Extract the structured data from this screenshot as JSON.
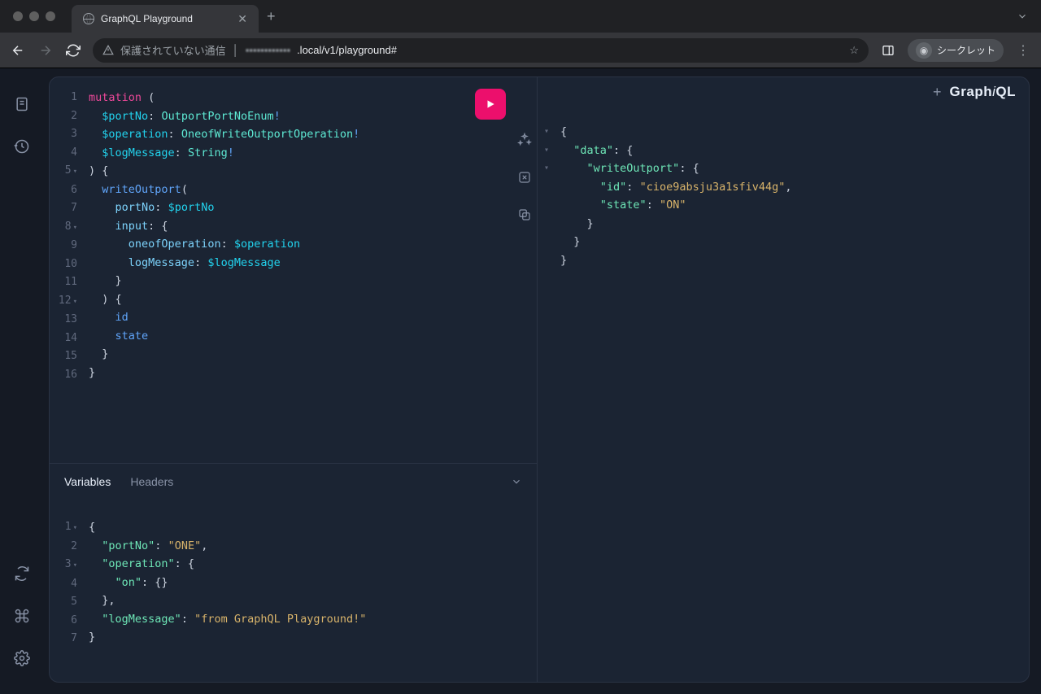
{
  "browser": {
    "tab_title": "GraphQL Playground",
    "address_warning": "保護されていない通信",
    "address_host_obscured": "▪▪▪▪▪▪▪▪▪▪▪▪",
    "address_path": ".local/v1/playground#",
    "incognito_label": "シークレット"
  },
  "brand": {
    "pre": "Graph",
    "i": "i",
    "post": "QL"
  },
  "vars_panel": {
    "tab_variables": "Variables",
    "tab_headers": "Headers"
  },
  "query": {
    "lines": [
      {
        "n": "1",
        "fold": "",
        "html": "<span class='k-mut'>mutation</span> <span class='k-punc'>(</span>"
      },
      {
        "n": "2",
        "fold": "",
        "html": "  <span class='k-var'>$portNo</span><span class='k-punc'>:</span> <span class='k-type'>OutportPortNoEnum</span><span class='k-bang'>!</span>"
      },
      {
        "n": "3",
        "fold": "",
        "html": "  <span class='k-var'>$operation</span><span class='k-punc'>:</span> <span class='k-type'>OneofWriteOutportOperation</span><span class='k-bang'>!</span>"
      },
      {
        "n": "4",
        "fold": "",
        "html": "  <span class='k-var'>$logMessage</span><span class='k-punc'>:</span> <span class='k-type'>String</span><span class='k-bang'>!</span>"
      },
      {
        "n": "5",
        "fold": "▾",
        "html": "<span class='k-punc'>) {</span>"
      },
      {
        "n": "6",
        "fold": "",
        "html": "  <span class='k-field'>writeOutport</span><span class='k-punc'>(</span>"
      },
      {
        "n": "7",
        "fold": "",
        "html": "    <span class='k-arg'>portNo</span><span class='k-punc'>:</span> <span class='k-var'>$portNo</span>"
      },
      {
        "n": "8",
        "fold": "▾",
        "html": "    <span class='k-arg'>input</span><span class='k-punc'>: {</span>"
      },
      {
        "n": "9",
        "fold": "",
        "html": "      <span class='k-arg'>oneofOperation</span><span class='k-punc'>:</span> <span class='k-var'>$operation</span>"
      },
      {
        "n": "10",
        "fold": "",
        "html": "      <span class='k-arg'>logMessage</span><span class='k-punc'>:</span> <span class='k-var'>$logMessage</span>"
      },
      {
        "n": "11",
        "fold": "",
        "html": "    <span class='k-punc'>}</span>"
      },
      {
        "n": "12",
        "fold": "▾",
        "html": "  <span class='k-punc'>) {</span>"
      },
      {
        "n": "13",
        "fold": "",
        "html": "    <span class='k-field'>id</span>"
      },
      {
        "n": "14",
        "fold": "",
        "html": "    <span class='k-field'>state</span>"
      },
      {
        "n": "15",
        "fold": "",
        "html": "  <span class='k-punc'>}</span>"
      },
      {
        "n": "16",
        "fold": "",
        "html": "<span class='k-punc'>}</span>"
      }
    ]
  },
  "variables": {
    "lines": [
      {
        "n": "1",
        "fold": "▾",
        "html": "<span class='k-punc'>{</span>"
      },
      {
        "n": "2",
        "fold": "",
        "html": "  <span class='k-key'>\"portNo\"</span><span class='k-punc'>:</span> <span class='k-str'>\"ONE\"</span><span class='k-punc'>,</span>"
      },
      {
        "n": "3",
        "fold": "▾",
        "html": "  <span class='k-key'>\"operation\"</span><span class='k-punc'>: {</span>"
      },
      {
        "n": "4",
        "fold": "",
        "html": "    <span class='k-key'>\"on\"</span><span class='k-punc'>: {}</span>"
      },
      {
        "n": "5",
        "fold": "",
        "html": "  <span class='k-punc'>},</span>"
      },
      {
        "n": "6",
        "fold": "",
        "html": "  <span class='k-key'>\"logMessage\"</span><span class='k-punc'>:</span> <span class='k-str'>\"from GraphQL Playground!\"</span>"
      },
      {
        "n": "7",
        "fold": "",
        "html": "<span class='k-punc'>}</span>"
      }
    ]
  },
  "response": {
    "lines": [
      {
        "fold": "▾",
        "html": "<span class='k-punc'>{</span>"
      },
      {
        "fold": "▾",
        "html": "  <span class='k-key'>\"data\"</span><span class='k-punc'>: {</span>"
      },
      {
        "fold": "▾",
        "html": "    <span class='k-key'>\"writeOutport\"</span><span class='k-punc'>: {</span>"
      },
      {
        "fold": "",
        "html": "      <span class='k-key'>\"id\"</span><span class='k-punc'>:</span> <span class='k-str'>\"cioe9absju3a1sfiv44g\"</span><span class='k-punc'>,</span>"
      },
      {
        "fold": "",
        "html": "      <span class='k-key'>\"state\"</span><span class='k-punc'>:</span> <span class='k-str'>\"ON\"</span>"
      },
      {
        "fold": "",
        "html": "    <span class='k-punc'>}</span>"
      },
      {
        "fold": "",
        "html": "  <span class='k-punc'>}</span>"
      },
      {
        "fold": "",
        "html": "<span class='k-punc'>}</span>"
      }
    ]
  }
}
